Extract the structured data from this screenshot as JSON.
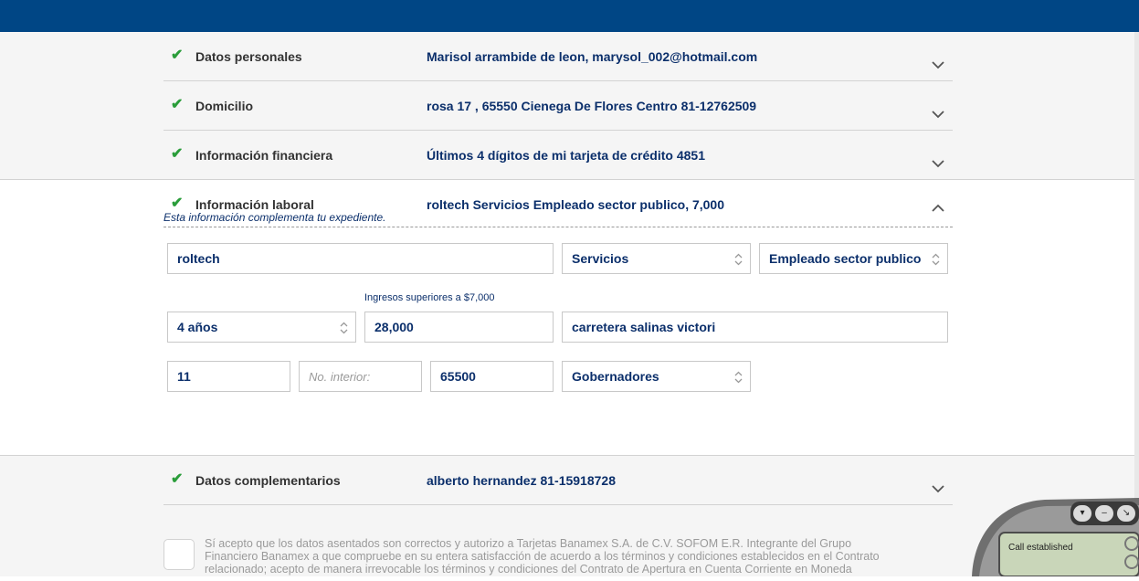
{
  "sections": [
    {
      "label": "Datos personales",
      "summary": "Marisol arrambide de leon, marysol_002@hotmail.com"
    },
    {
      "label": "Domicilio",
      "summary": "rosa 17 , 65550 Cienega De Flores Centro 81-12762509"
    },
    {
      "label": "Información financiera",
      "summary": "Últimos 4 dígitos de mi tarjeta de crédito 4851"
    },
    {
      "label": "Información laboral",
      "summary": "roltech Servicios Empleado sector publico, 7,000"
    },
    {
      "label": "Datos complementarios",
      "summary": "alberto hernandez 81-15918728"
    }
  ],
  "laboral": {
    "hint": "Esta información complementa tu expediente.",
    "company": "roltech",
    "sector": "Servicios",
    "occupation": "Empleado sector publico",
    "income_label": "Ingresos superiores a $7,000",
    "years": "4 años",
    "income": "28,000",
    "street": "carretera salinas victori",
    "ext_number": "11",
    "int_number_placeholder": "No. interior:",
    "zip": "65500",
    "colony": "Gobernadores"
  },
  "terms": "Sí acepto que los datos asentados son correctos y autorizo a Tarjetas Banamex S.A. de C.V. SOFOM E.R. Integrante del Grupo Financiero Banamex a que compruebe en su entera satisfacción de acuerdo a los términos y condiciones establecidos en el Contrato relacionado; acepto de manera irrevocable los términos y condiciones del Contrato de Apertura en Cuenta Corriente en Moneda",
  "phone": {
    "status": "Call established"
  },
  "colors": {
    "header": "#004685",
    "accent_text": "#0b2f6b",
    "check": "#2a9d3a"
  },
  "icons": {
    "check": "check-icon",
    "chevron_down": "chevron-down-icon",
    "chevron_up": "chevron-up-icon",
    "select": "select-arrows-icon"
  }
}
